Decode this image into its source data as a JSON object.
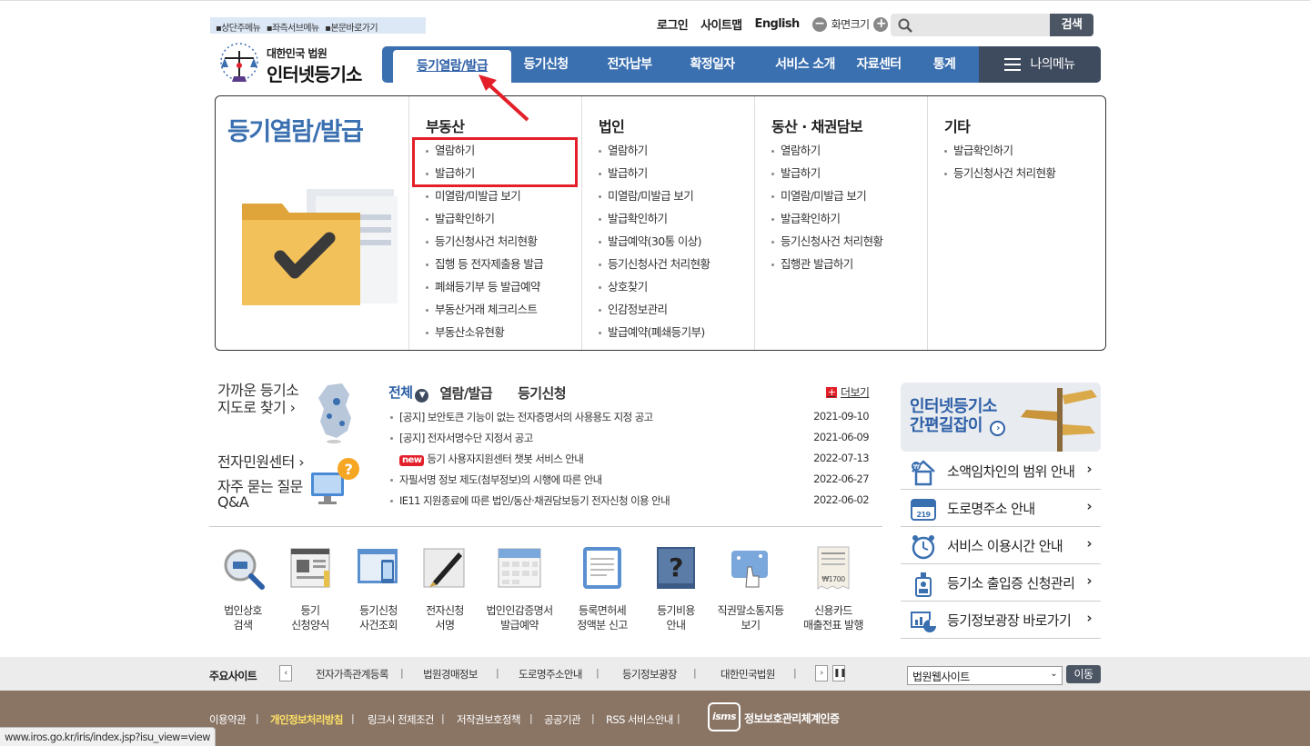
{
  "skip_links": [
    "▪상단주메뉴",
    "▪좌측서브메뉴",
    "▪본문바로가기"
  ],
  "util": {
    "login": "로그인",
    "sitemap": "사이트맵",
    "english": "English",
    "zoom_label": "화면크기",
    "search_button": "검색",
    "search_placeholder": ""
  },
  "logo": {
    "line1": "대한민국 법원",
    "line2": "인터넷등기소"
  },
  "gnb": {
    "items": [
      "등기열람/발급",
      "등기신청",
      "전자납부",
      "확정일자",
      "서비스 소개",
      "자료센터",
      "통계"
    ],
    "my_menu": "나의메뉴"
  },
  "mega": {
    "title": "등기열람/발급",
    "columns": [
      {
        "title": "부동산",
        "items": [
          "열람하기",
          "발급하기",
          "미열람/미발급 보기",
          "발급확인하기",
          "등기신청사건 처리현황",
          "집행 등 전자제출용 발급",
          "폐쇄등기부 등 발급예약",
          "부동산거래 체크리스트",
          "부동산소유현황"
        ]
      },
      {
        "title": "법인",
        "items": [
          "열람하기",
          "발급하기",
          "미열람/미발급 보기",
          "발급확인하기",
          "발급예약(30통 이상)",
          "등기신청사건 처리현황",
          "상호찾기",
          "인감정보관리",
          "발급예약(폐쇄등기부)"
        ]
      },
      {
        "title": "동산 · 채권담보",
        "items": [
          "열람하기",
          "발급하기",
          "미열람/미발급 보기",
          "발급확인하기",
          "등기신청사건 처리현황",
          "집행관 발급하기"
        ]
      },
      {
        "title": "기타",
        "items": [
          "발급확인하기",
          "등기신청사건 처리현황"
        ]
      }
    ]
  },
  "left": {
    "near1": "가까운 등기소",
    "near2": "지도로 찾기 ›",
    "minwon": "전자민원센터 ›",
    "faq1": "자주 묻는 질문",
    "faq2": "Q&A"
  },
  "news": {
    "tabs": [
      "전체",
      "열람/발급",
      "등기신청"
    ],
    "more": "더보기",
    "new_badge": "new",
    "items": [
      {
        "title": "[공지] 보안토큰 기능이 없는 전자증명서의 사용용도 지정 공고",
        "date": "2021-09-10",
        "is_new": false
      },
      {
        "title": "[공지] 전자서명수단 지정서 공고",
        "date": "2021-06-09",
        "is_new": false
      },
      {
        "title": "등기 사용자지원센터 챗봇 서비스 안내",
        "date": "2022-07-13",
        "is_new": true
      },
      {
        "title": "자필서명 정보 제도(첨부정보)의 시행에 따른 안내",
        "date": "2022-06-27",
        "is_new": false
      },
      {
        "title": "IE11 지원종료에 따른 법인/동산·채권담보등기 전자신청 이용 안내",
        "date": "2022-06-02",
        "is_new": false
      }
    ]
  },
  "quick": [
    {
      "l1": "법인상호",
      "l2": "검색"
    },
    {
      "l1": "등기",
      "l2": "신청양식"
    },
    {
      "l1": "등기신청",
      "l2": "사건조회"
    },
    {
      "l1": "전자신청",
      "l2": "서명"
    },
    {
      "l1": "법인인감증명서",
      "l2": "발급예약"
    },
    {
      "l1": "등록면허세",
      "l2": "정액분 신고"
    },
    {
      "l1": "등기비용",
      "l2": "안내"
    },
    {
      "l1": "직권말소통지등",
      "l2": "보기"
    },
    {
      "l1": "신용카드",
      "l2": "매출전표 발행"
    }
  ],
  "guide": {
    "line1": "인터넷등기소",
    "line2": "간편길잡이"
  },
  "right_links": [
    "소액임차인의 범위 안내",
    "도로명주소 안내",
    "서비스 이용시간 안내",
    "등기소 출입증 신청관리",
    "등기정보광장 바로가기"
  ],
  "sites": {
    "label": "주요사이트",
    "items": [
      "전자가족관계등록",
      "법원경매정보",
      "도로명주소안내",
      "등기정보광장",
      "대한민국법원"
    ],
    "select_value": "법원웹사이트",
    "go": "이동"
  },
  "footer": {
    "links": [
      "이용약관",
      "개인정보처리방침",
      "링크시 전제조건",
      "저작권보호정책",
      "공공기관",
      "RSS 서비스안내"
    ],
    "isms_badge": "isms",
    "isms_text": "정보보호관리체계인증"
  },
  "status_url": "www.iros.go.kr/iris/index.jsp?isu_view=view",
  "colors": {
    "brand_blue": "#3a6fb0",
    "dark_nav": "#3e4a5e",
    "highlight_red": "#e3202a",
    "footer_brown": "#8a7565"
  }
}
